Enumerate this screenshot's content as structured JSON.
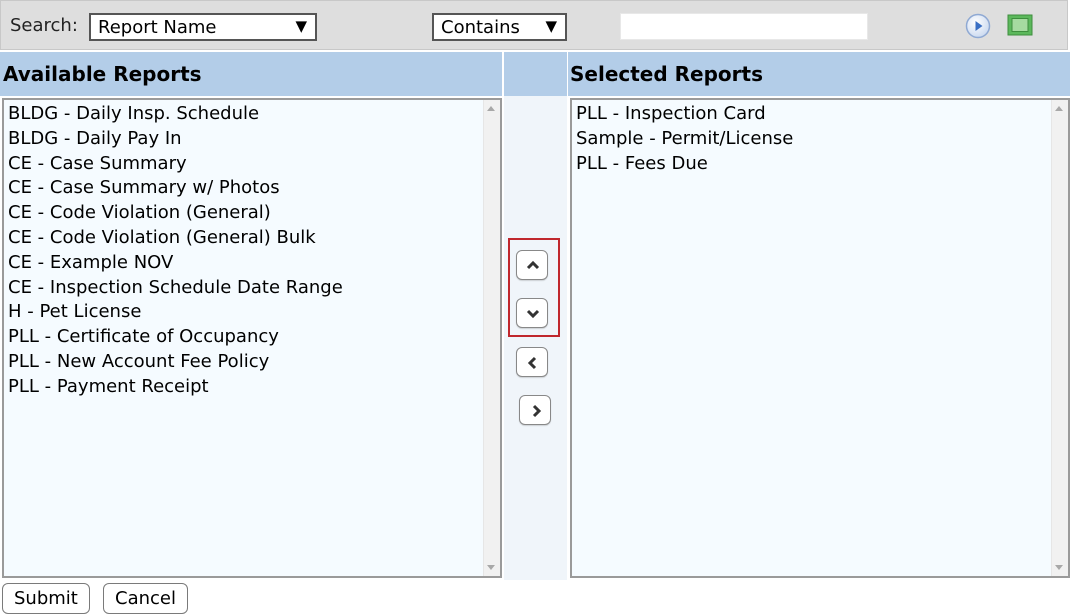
{
  "search": {
    "label": "Search:",
    "field_select": "Report Name",
    "operator_select": "Contains",
    "query_value": ""
  },
  "available": {
    "header": "Available Reports",
    "items": [
      "BLDG - Daily Insp. Schedule",
      "BLDG - Daily Pay In",
      "CE - Case Summary",
      "CE - Case Summary w/ Photos",
      "CE - Code Violation (General)",
      "CE - Code Violation (General) Bulk",
      "CE - Example NOV",
      "CE - Inspection Schedule Date Range",
      "H - Pet License",
      "PLL - Certificate of Occupancy",
      "PLL - New Account Fee Policy",
      "PLL - Payment Receipt"
    ]
  },
  "selected": {
    "header": "Selected Reports",
    "items": [
      "PLL - Inspection Card",
      "Sample - Permit/License",
      "PLL - Fees Due"
    ]
  },
  "buttons": {
    "submit": "Submit",
    "cancel": "Cancel"
  },
  "icons": {
    "go": "play-circle-icon",
    "screen": "screen-icon",
    "move_up": "chevron-up-icon",
    "move_down": "chevron-down-icon",
    "move_left": "chevron-left-icon",
    "move_right": "chevron-right-icon"
  },
  "colors": {
    "header_bg": "#b3cde8",
    "list_bg": "#f5fbff",
    "toolbar_bg": "#dedede",
    "highlight_border": "#c0272d",
    "screen_icon": "#5cb85c"
  }
}
